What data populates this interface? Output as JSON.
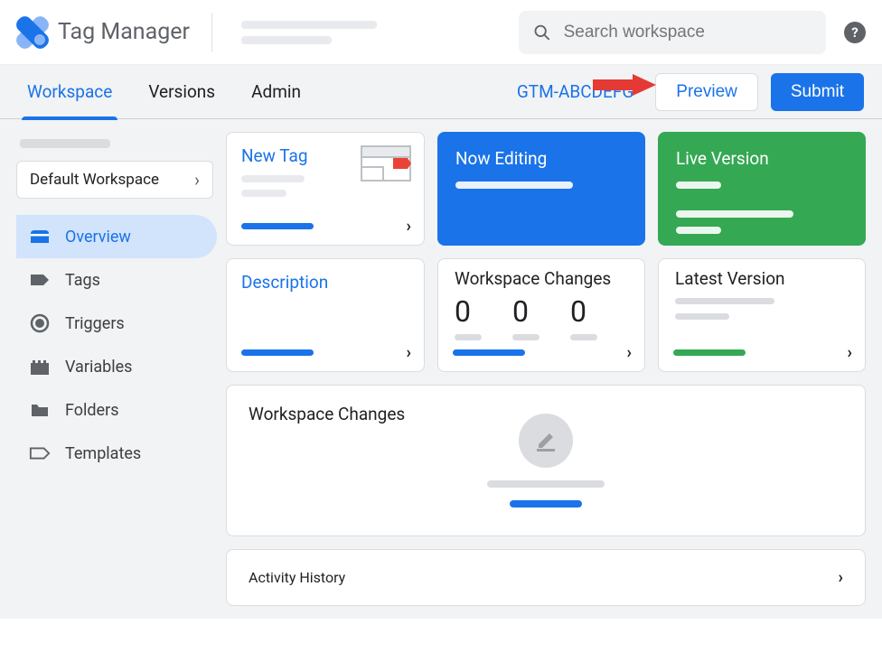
{
  "product_name": "Tag Manager",
  "search": {
    "placeholder": "Search workspace"
  },
  "tabs": {
    "workspace": "Workspace",
    "versions": "Versions",
    "admin": "Admin"
  },
  "container_id": "GTM-ABCDEFG",
  "actions": {
    "preview": "Preview",
    "submit": "Submit"
  },
  "workspace_selector": "Default Workspace",
  "nav": {
    "overview": "Overview",
    "tags": "Tags",
    "triggers": "Triggers",
    "variables": "Variables",
    "folders": "Folders",
    "templates": "Templates"
  },
  "cards": {
    "new_tag": "New Tag",
    "now_editing": "Now Editing",
    "live_version": "Live Version",
    "description": "Description",
    "workspace_changes": "Workspace Changes",
    "wc_value_1": "0",
    "wc_value_2": "0",
    "wc_value_3": "0",
    "latest_version": "Latest Version",
    "workspace_changes_panel": "Workspace Changes",
    "activity_history": "Activity History"
  }
}
